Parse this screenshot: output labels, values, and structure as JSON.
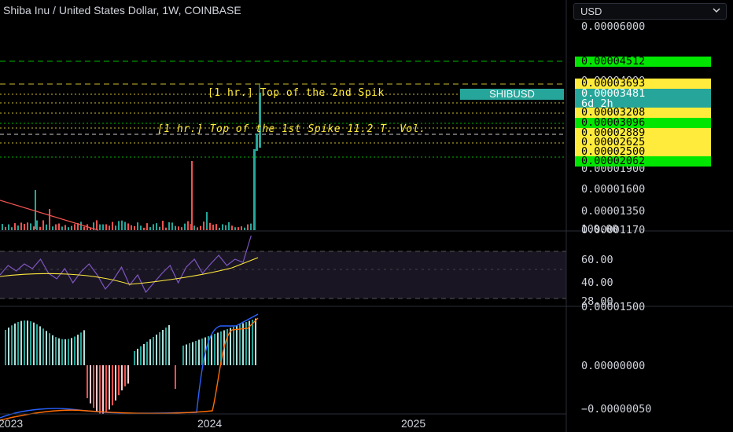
{
  "header": {
    "title": "Shiba Inu / United States Dollar, 1W, COINBASE",
    "currency_button": "USD"
  },
  "price_axis": {
    "ticks": [
      "0.00006000",
      "0.00004000",
      "0.00001900",
      "0.00001600",
      "0.00001350",
      "0.00001170"
    ],
    "level_tags": [
      {
        "value": "0.00004512",
        "color": "green"
      },
      {
        "value": "0.00003693",
        "color": "yellow"
      },
      {
        "value": "0.00003208",
        "color": "yellow"
      },
      {
        "value": "0.00003096",
        "color": "green"
      },
      {
        "value": "0.00002889",
        "color": "yellow"
      },
      {
        "value": "0.00002625",
        "color": "yellow"
      },
      {
        "value": "0.00002500",
        "color": "yellow"
      },
      {
        "value": "0.00002062",
        "color": "green"
      }
    ],
    "last_price": "0.00003481",
    "countdown": "6d 2h",
    "symbol_badge": "SHIBUSD"
  },
  "annotations": {
    "spike2": "[1 hr.] Top of the 2nd Spik",
    "spike1": "[1 hr.] Top of the 1st Spike 11.2 T. Vol."
  },
  "rsi_axis": {
    "ticks": [
      "100.00",
      "60.00",
      "40.00",
      "28.00"
    ]
  },
  "macd_axis": {
    "ticks": [
      "0.00001500",
      "0.00000000",
      "−0.00000050"
    ]
  },
  "time_axis": {
    "labels": [
      "2023",
      "2024",
      "2025"
    ]
  },
  "colors": {
    "up": "#26a69a",
    "down": "#ef5350",
    "green_level": "#00e600",
    "yellow_level": "#ffeb3b",
    "rsi_line": "#7e57c2",
    "rsi_ma": "#ffeb3b",
    "macd_line": "#2962ff",
    "signal_line": "#ff6d00"
  }
}
